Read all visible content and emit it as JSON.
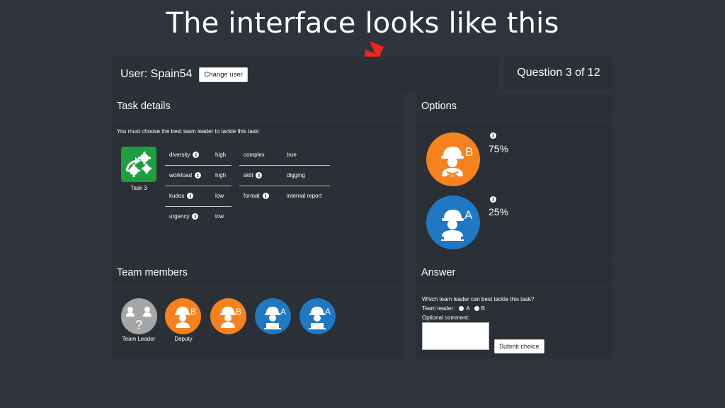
{
  "slide_title": "The interface looks like this",
  "header": {
    "user_label": "User: Spain54",
    "change_user_label": "Change user",
    "question_label": "Question 3 of 12"
  },
  "task_details": {
    "heading": "Task details",
    "intro": "You must choose the best team leader to tackle this task:",
    "task_name": "Task 3",
    "attributes_left": [
      {
        "key": "diversity",
        "value": "high"
      },
      {
        "key": "workload",
        "value": "high"
      },
      {
        "key": "kudos",
        "value": "low"
      },
      {
        "key": "urgency",
        "value": "low"
      }
    ],
    "attributes_right": [
      {
        "key": "complex",
        "value": "true"
      },
      {
        "key": "skill",
        "value": "digging"
      },
      {
        "key": "format",
        "value": "internal report"
      }
    ]
  },
  "options": {
    "heading": "Options",
    "items": [
      {
        "letter": "B",
        "percent": "75%",
        "color": "#f5821f"
      },
      {
        "letter": "A",
        "percent": "25%",
        "color": "#1f78c1"
      }
    ]
  },
  "team_members": {
    "heading": "Team members",
    "members": [
      {
        "label": "Team Leader",
        "letter": "?",
        "color": "#a6a6a6"
      },
      {
        "label": "Deputy",
        "letter": "B",
        "color": "#f5821f"
      },
      {
        "label": "",
        "letter": "B",
        "color": "#f5821f"
      },
      {
        "label": "",
        "letter": "A",
        "color": "#1f78c1"
      },
      {
        "label": "",
        "letter": "A",
        "color": "#1f78c1"
      }
    ]
  },
  "answer": {
    "heading": "Answer",
    "question": "Which team leader can best tackle this task?",
    "team_leader_label": "Team leader:",
    "option_a": "A",
    "option_b": "B",
    "comment_label": "Optional comment:",
    "submit_label": "Submit choice"
  },
  "info_glyph": "i",
  "colors": {
    "background": "#2f333b",
    "panel": "#2b2f36",
    "task_icon": "#1f9e3f",
    "arrow": "#e52b1f"
  }
}
